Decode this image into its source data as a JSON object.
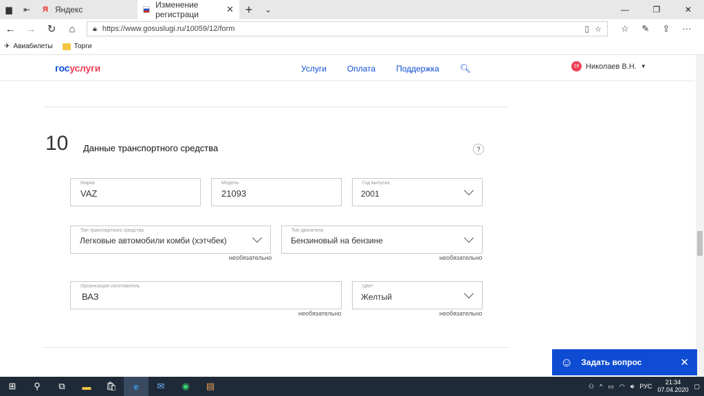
{
  "browser": {
    "tabs": [
      {
        "label": "Яндекс",
        "active": false
      },
      {
        "label": "Изменение регистраци",
        "active": true
      }
    ],
    "url": "https://www.gosuslugi.ru/10059/12/form",
    "bookmarks": [
      "Авиабилеты",
      "Торги"
    ]
  },
  "site": {
    "logo_a": "гос",
    "logo_b": "услуги",
    "nav": [
      "Услуги",
      "Оплата",
      "Поддержка"
    ],
    "user_badge": "16",
    "user_name": "Николаев В.Н."
  },
  "section": {
    "number": "10",
    "title": "Данные транспортного средства",
    "help": "?"
  },
  "fields": {
    "brand": {
      "label": "Марка",
      "value": "VAZ"
    },
    "model": {
      "label": "Модель",
      "value": "21093"
    },
    "year": {
      "label": "Год выпуска",
      "value": "2001"
    },
    "vehicle_type": {
      "label": "Тип транспортного средства",
      "value": "Легковые автомобили комби (хэтчбек)",
      "note": "необязательно"
    },
    "engine_type": {
      "label": "Тип двигателя",
      "value": "Бензиновый на бензине",
      "note": "необязательно"
    },
    "manufacturer": {
      "label": "Организация изготовитель",
      "value": "ВАЗ",
      "note": "необязательно"
    },
    "color": {
      "label": "Цвет",
      "value": "Желтый",
      "note": "необязательно"
    }
  },
  "chat": {
    "label": "Задать вопрос"
  },
  "taskbar": {
    "lang": "РУС",
    "time": "21:34",
    "date": "07.04.2020"
  },
  "colors": {
    "brand_blue": "#0d4cd3",
    "brand_red": "#ee3f58"
  }
}
